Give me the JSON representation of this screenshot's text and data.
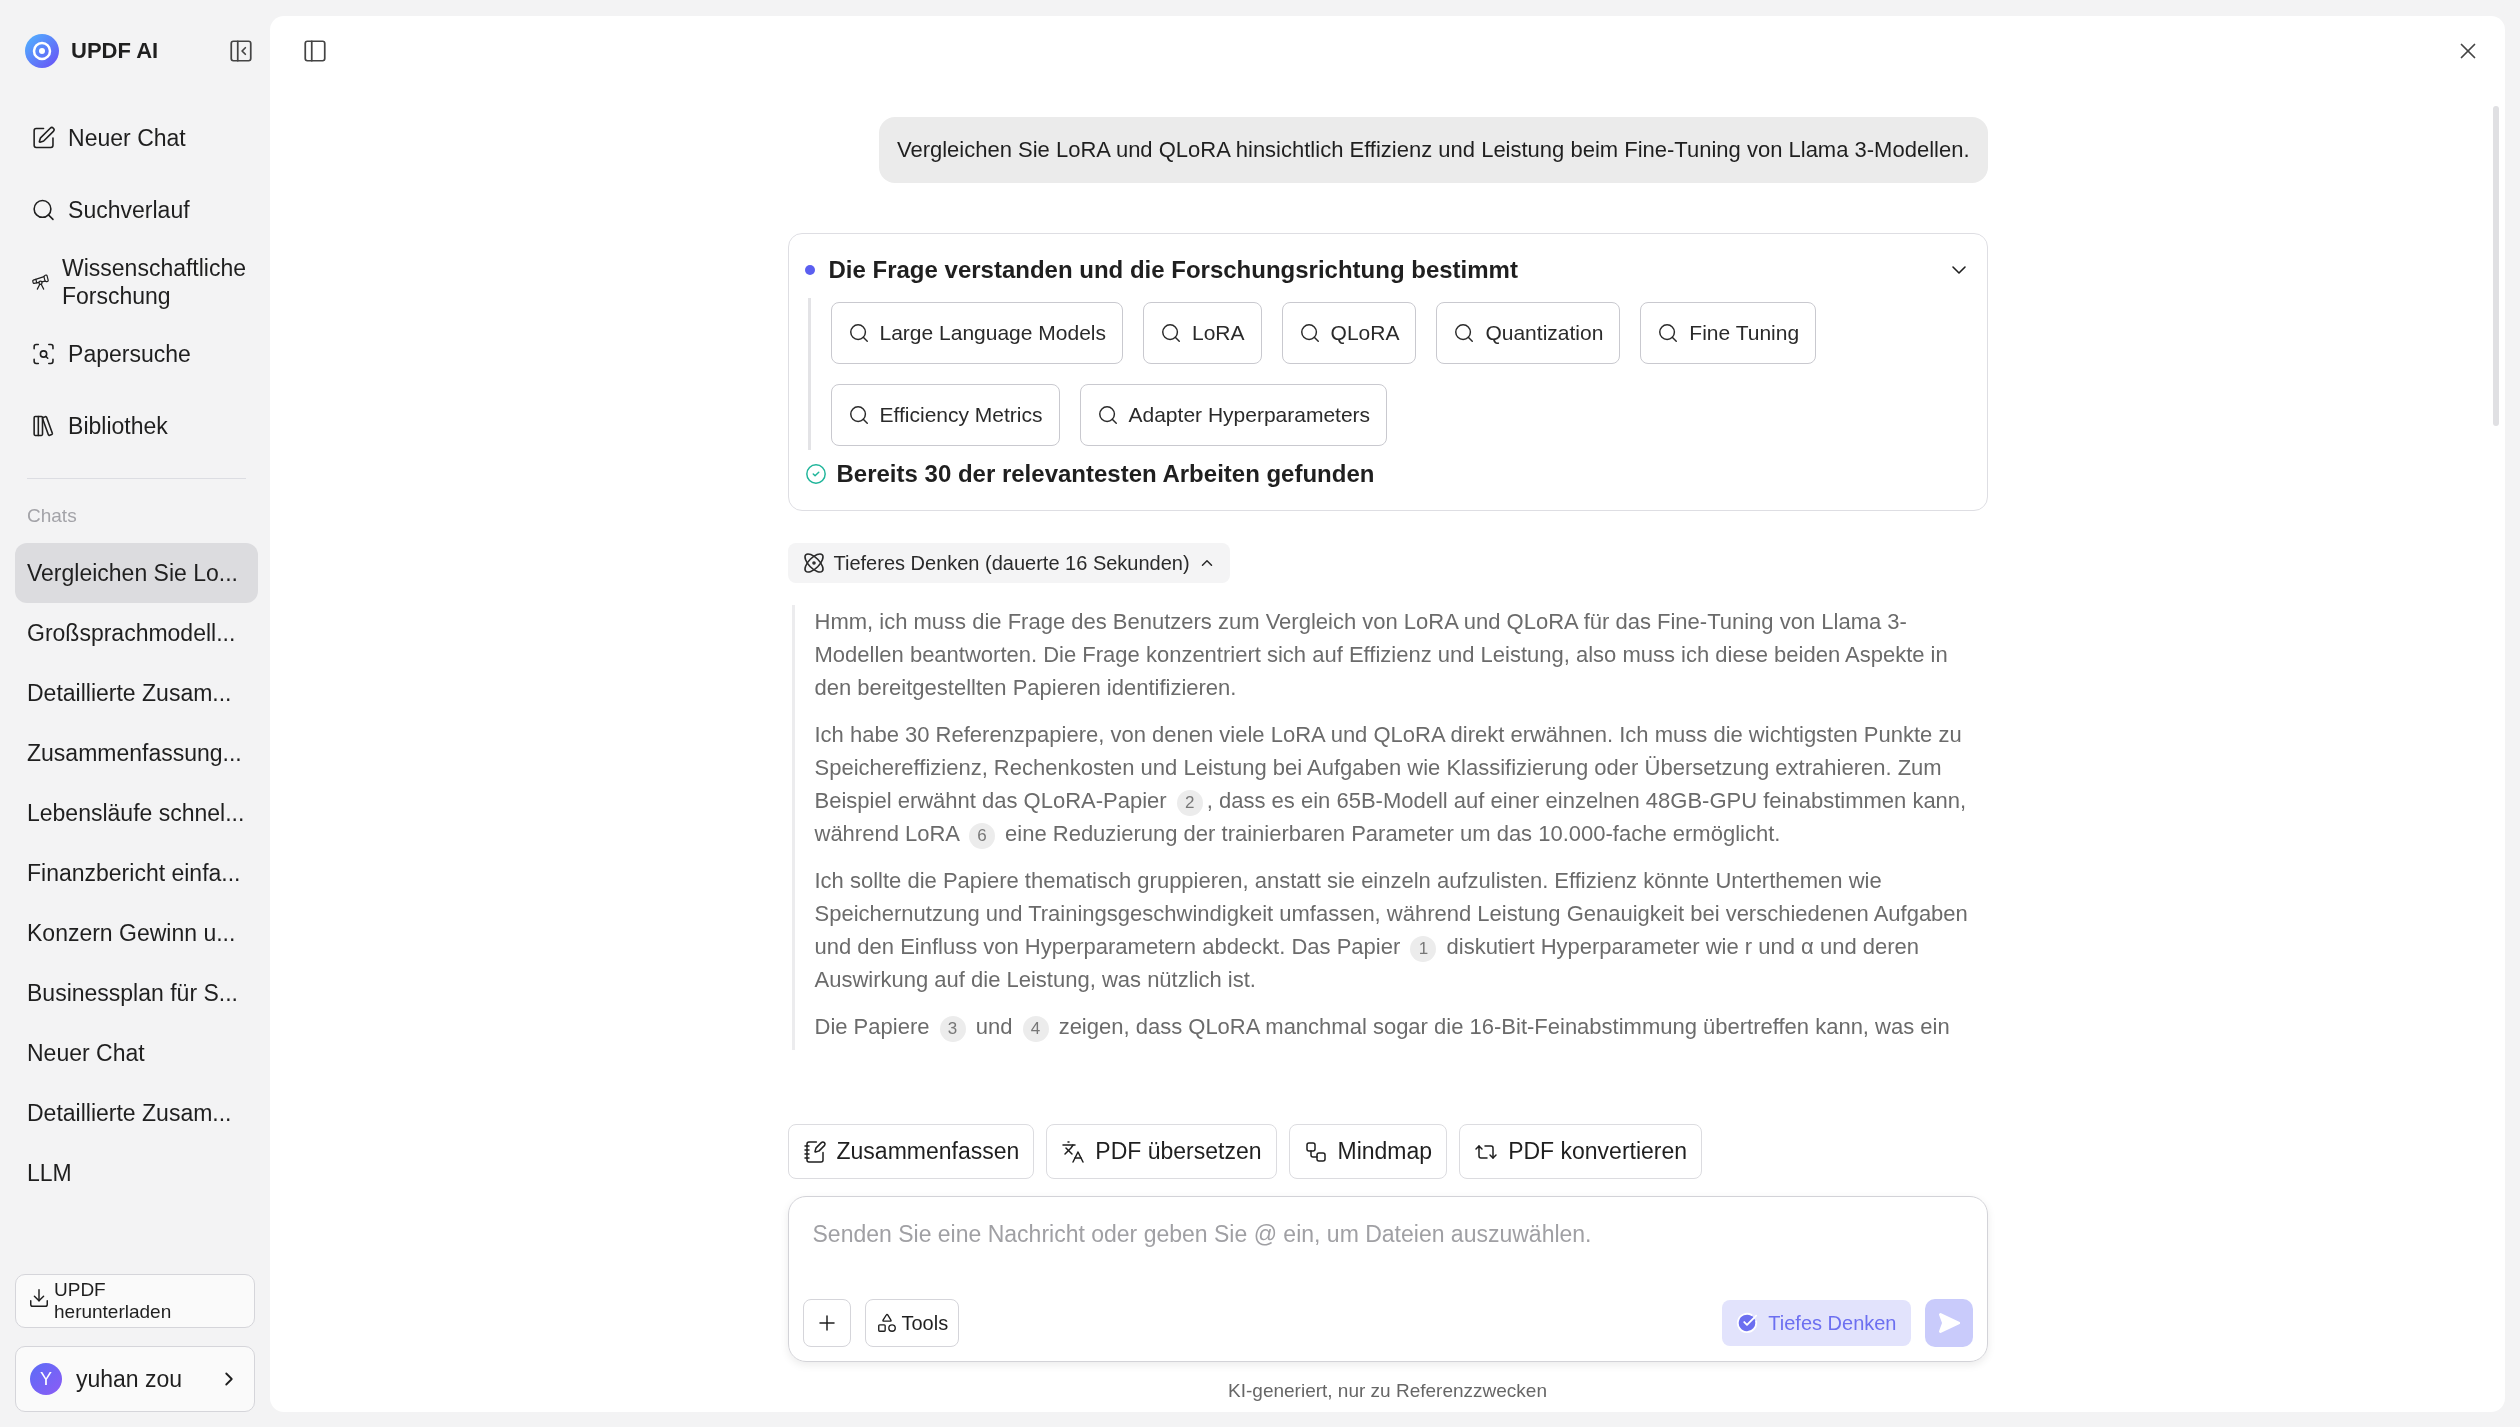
{
  "app": {
    "name": "UPDF AI"
  },
  "nav": [
    {
      "label": "Neuer Chat",
      "kind": "new"
    },
    {
      "label": "Suchverlauf",
      "kind": "search"
    },
    {
      "label": "Wissenschaftliche Forschung",
      "kind": "research"
    },
    {
      "label": "Papersuche",
      "kind": "papers"
    },
    {
      "label": "Bibliothek",
      "kind": "library"
    }
  ],
  "chats_heading": "Chats",
  "chats": [
    {
      "title": "Vergleichen Sie Lo...",
      "selected": true
    },
    {
      "title": "Großsprachmodell...",
      "selected": false
    },
    {
      "title": "Detaillierte Zusam...",
      "selected": false
    },
    {
      "title": "Zusammenfassung...",
      "selected": false
    },
    {
      "title": "Lebensläufe schnel...",
      "selected": false
    },
    {
      "title": "Finanzbericht einfa...",
      "selected": false
    },
    {
      "title": "Konzern Gewinn u...",
      "selected": false
    },
    {
      "title": "Businessplan für S...",
      "selected": false
    },
    {
      "title": "Neuer Chat",
      "selected": false
    },
    {
      "title": "Detaillierte Zusam...",
      "selected": false
    },
    {
      "title": "LLM",
      "selected": false
    }
  ],
  "download_button": "UPDF herunterladen",
  "user": {
    "initial": "Y",
    "name": "yuhan zou"
  },
  "question": "Vergleichen Sie LoRA und QLoRA hinsichtlich Effizienz und Leistung beim Fine-Tuning von Llama 3-Modellen.",
  "research": {
    "title": "Die Frage verstanden und die Forschungsrichtung bestimmt",
    "expanded": true,
    "keywords": [
      "Large Language Models",
      "LoRA",
      "QLoRA",
      "Quantization",
      "Fine Tuning",
      "Efficiency Metrics",
      "Adapter Hyperparameters"
    ],
    "result": "Bereits 30 der relevantesten Arbeiten gefunden"
  },
  "thinking": {
    "label": "Tieferes Denken (dauerte 16 Sekunden)",
    "expanded": true,
    "paragraphs": [
      [
        {
          "kind": "text",
          "text": "Hmm, ich muss die Frage des Benutzers zum Vergleich von LoRA und QLoRA für das Fine-Tuning von Llama 3-Modellen beantworten. Die Frage konzentriert sich auf Effizienz und Leistung, also muss ich diese beiden Aspekte in den bereitgestellten Papieren identifizieren."
        }
      ],
      [
        {
          "kind": "text",
          "text": "Ich habe 30 Referenzpapiere, von denen viele LoRA und QLoRA direkt erwähnen. Ich muss die wichtigsten Punkte zu Speichereffizienz, Rechenkosten und Leistung bei Aufgaben wie Klassifizierung oder Übersetzung extrahieren. Zum Beispiel erwähnt das QLoRA-Papier "
        },
        {
          "kind": "cite",
          "text": "2"
        },
        {
          "kind": "text",
          "text": ", dass es ein 65B-Modell auf einer einzelnen 48GB-GPU feinabstimmen kann, während LoRA "
        },
        {
          "kind": "cite",
          "text": "6"
        },
        {
          "kind": "text",
          "text": " eine Reduzierung der trainierbaren Parameter um das 10.000-fache ermöglicht."
        }
      ],
      [
        {
          "kind": "text",
          "text": "Ich sollte die Papiere thematisch gruppieren, anstatt sie einzeln aufzulisten. Effizienz könnte Unterthemen wie Speichernutzung und Trainingsgeschwindigkeit umfassen, während Leistung Genauigkeit bei verschiedenen Aufgaben und den Einfluss von Hyperparametern abdeckt. Das Papier "
        },
        {
          "kind": "cite",
          "text": "1"
        },
        {
          "kind": "text",
          "text": " diskutiert Hyperparameter wie r und α und deren Auswirkung auf die Leistung, was nützlich ist."
        }
      ],
      [
        {
          "kind": "text",
          "text": "Die Papiere "
        },
        {
          "kind": "cite",
          "text": "3"
        },
        {
          "kind": "text",
          "text": " und "
        },
        {
          "kind": "cite",
          "text": "4"
        },
        {
          "kind": "text",
          "text": " zeigen, dass QLoRA manchmal sogar die 16-Bit-Feinabstimmung übertreffen kann, was ein"
        }
      ]
    ]
  },
  "actions": [
    {
      "label": "Zusammenfassen",
      "kind": "summarize"
    },
    {
      "label": "PDF übersetzen",
      "kind": "translate"
    },
    {
      "label": "Mindmap",
      "kind": "mindmap"
    },
    {
      "label": "PDF konvertieren",
      "kind": "convert"
    }
  ],
  "composer": {
    "placeholder": "Senden Sie eine Nachricht oder geben Sie @ ein, um Dateien auszuwählen.",
    "tools_label": "Tools",
    "deep_thinking": {
      "label": "Tiefes Denken",
      "on": true
    }
  },
  "footer": "KI-generiert, nur zu Referenzzwecken"
}
